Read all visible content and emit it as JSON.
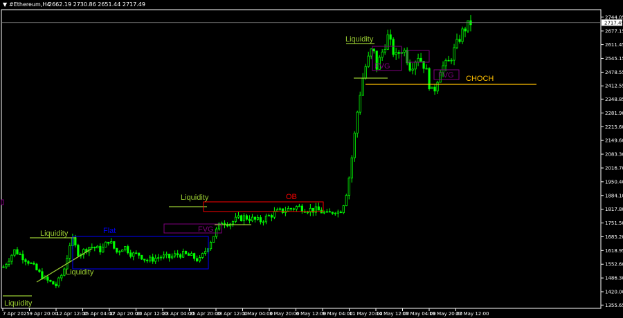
{
  "header": {
    "symbol": "#Ethereum,H4",
    "ohlc": "2662.19 2730.86 2651.44 2717.49"
  },
  "colors": {
    "background": "#000000",
    "candle": "#00ff00",
    "axis": "#ffffff",
    "grid_line": "#808080",
    "liquidity": "#9acd32",
    "flat": "#0000ff",
    "fvg": "#800080",
    "ob": "#ff0000",
    "choch": "#ffc000"
  },
  "chart_data": {
    "type": "candlestick",
    "y_ticks": [
      "2744.05",
      "2677.15",
      "2611.45",
      "2545.15",
      "2478.55",
      "2412.55",
      "2348.85",
      "2281.90",
      "2215.60",
      "2149.60",
      "2083.30",
      "2016.70",
      "1950.40",
      "1884.10",
      "1817.80",
      "1751.50",
      "1685.20",
      "1618.95",
      "1552.60",
      "1486.30",
      "1420.00",
      "1355.65"
    ],
    "ylim": [
      1340,
      2780
    ],
    "current_price": "2717.49",
    "x_ticks": [
      "7 Apr 2025",
      "9 Apr 20:00",
      "12 Apr 12:00",
      "15 Apr 04:00",
      "17 Apr 20:00",
      "20 Apr 12:00",
      "23 Apr 04:00",
      "25 Apr 20:00",
      "28 Apr 12:00",
      "1 May 04:00",
      "3 May 20:00",
      "6 May 12:00",
      "9 May 04:00",
      "11 May 20:00",
      "14 May 12:00",
      "17 May 04:00",
      "19 May 20:00",
      "22 May 12:00"
    ],
    "price_path": [
      [
        0,
        1540
      ],
      [
        3,
        1620
      ],
      [
        7,
        1560
      ],
      [
        11,
        1480
      ],
      [
        14,
        1450
      ],
      [
        16,
        1520
      ],
      [
        18,
        1680
      ],
      [
        20,
        1600
      ],
      [
        23,
        1640
      ],
      [
        26,
        1620
      ],
      [
        28,
        1670
      ],
      [
        30,
        1610
      ],
      [
        32,
        1640
      ],
      [
        34,
        1600
      ],
      [
        36,
        1600
      ],
      [
        38,
        1570
      ],
      [
        40,
        1580
      ],
      [
        42,
        1590
      ],
      [
        44,
        1585
      ],
      [
        46,
        1600
      ],
      [
        48,
        1600
      ],
      [
        50,
        1590
      ],
      [
        52,
        1570
      ],
      [
        54,
        1630
      ],
      [
        56,
        1700
      ],
      [
        58,
        1760
      ],
      [
        60,
        1750
      ],
      [
        62,
        1770
      ],
      [
        64,
        1780
      ],
      [
        66,
        1770
      ],
      [
        68,
        1760
      ],
      [
        70,
        1780
      ],
      [
        72,
        1800
      ],
      [
        74,
        1810
      ],
      [
        76,
        1820
      ],
      [
        78,
        1830
      ],
      [
        80,
        1820
      ],
      [
        82,
        1815
      ],
      [
        84,
        1810
      ],
      [
        86,
        1790
      ],
      [
        88,
        1815
      ],
      [
        89,
        1800
      ],
      [
        90,
        1830
      ],
      [
        91,
        1900
      ],
      [
        92,
        2000
      ],
      [
        93,
        2150
      ],
      [
        94,
        2300
      ],
      [
        95,
        2420
      ],
      [
        96,
        2500
      ],
      [
        97,
        2550
      ],
      [
        98,
        2600
      ],
      [
        99,
        2500
      ],
      [
        100,
        2550
      ],
      [
        102,
        2650
      ],
      [
        104,
        2550
      ],
      [
        106,
        2600
      ],
      [
        108,
        2500
      ],
      [
        110,
        2560
      ],
      [
        112,
        2500
      ],
      [
        113,
        2420
      ],
      [
        114,
        2370
      ],
      [
        116,
        2500
      ],
      [
        118,
        2520
      ],
      [
        120,
        2600
      ],
      [
        122,
        2680
      ],
      [
        124,
        2717
      ]
    ],
    "annotations": {
      "liquidity_label": "Liquidity",
      "flat_label": "Flat",
      "fvg_label": "FVG",
      "ob_label": "OB",
      "choch_label": "CHOCH"
    }
  }
}
